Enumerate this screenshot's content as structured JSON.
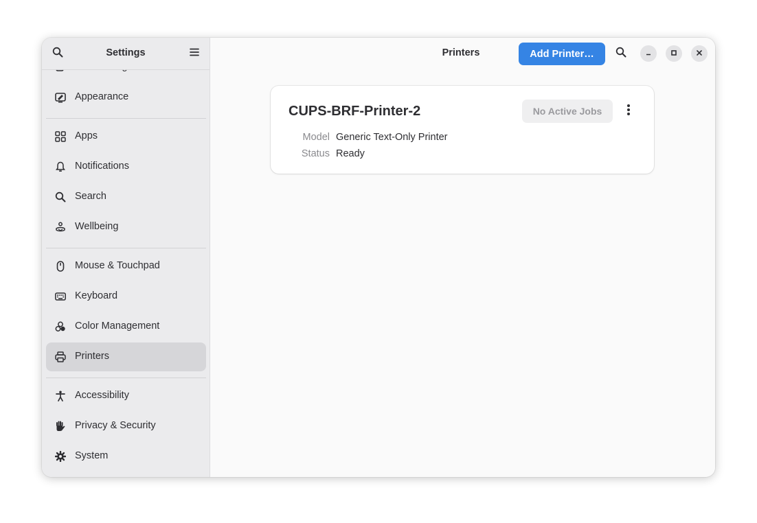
{
  "sidebar": {
    "title": "Settings",
    "items": [
      {
        "label": "Multitasking"
      },
      {
        "label": "Appearance"
      },
      {
        "label": "Apps"
      },
      {
        "label": "Notifications"
      },
      {
        "label": "Search"
      },
      {
        "label": "Wellbeing"
      },
      {
        "label": "Mouse & Touchpad"
      },
      {
        "label": "Keyboard"
      },
      {
        "label": "Color Management"
      },
      {
        "label": "Printers"
      },
      {
        "label": "Accessibility"
      },
      {
        "label": "Privacy & Security"
      },
      {
        "label": "System"
      }
    ],
    "selected": "Printers"
  },
  "header": {
    "title": "Printers",
    "add_printer_label": "Add Printer…"
  },
  "printer": {
    "name": "CUPS-BRF-Printer-2",
    "jobs_label": "No Active Jobs",
    "model_key": "Model",
    "model_value": "Generic Text-Only Printer",
    "status_key": "Status",
    "status_value": "Ready"
  },
  "colors": {
    "accent": "#3584e4",
    "sidebar_bg": "#ebebed",
    "selected_bg": "#d6d6d9"
  }
}
